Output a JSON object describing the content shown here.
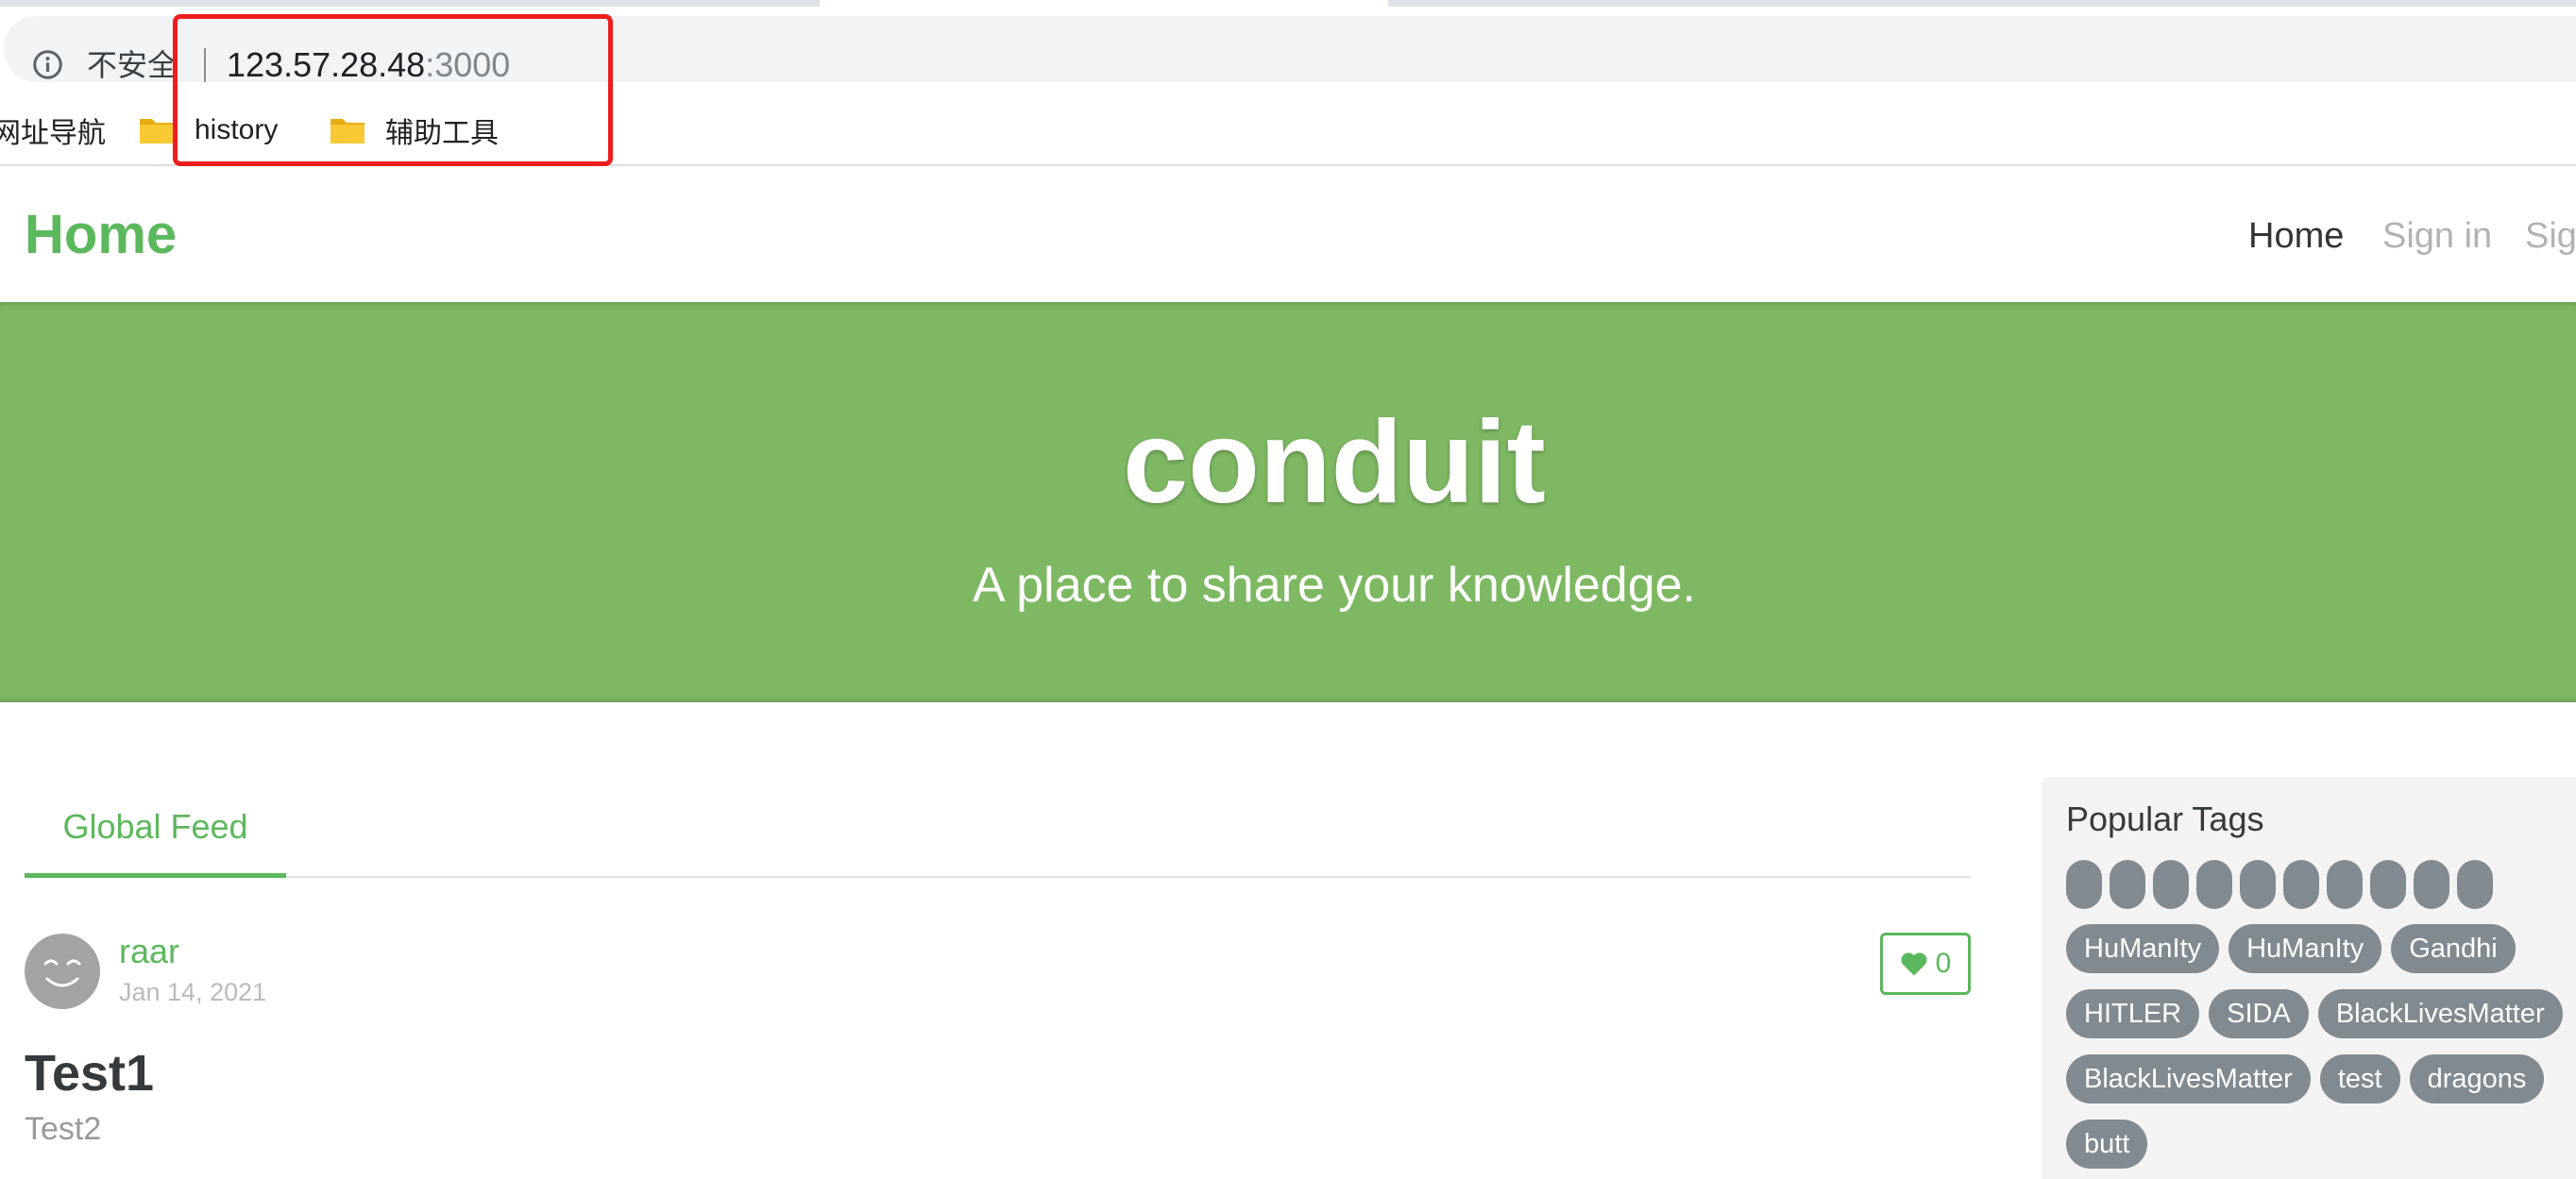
{
  "browser": {
    "insecure_label": "不安全",
    "url_host": "123.57.28.48",
    "url_port": ":3000",
    "bookmarks": [
      {
        "label": "网址导航",
        "icon": "none"
      },
      {
        "label": "history",
        "icon": "folder-icon"
      },
      {
        "label": "辅助工具",
        "icon": "folder-icon"
      }
    ],
    "highlight_color": "#ee1d1d"
  },
  "navbar": {
    "brand": "Home",
    "links": [
      {
        "label": "Home",
        "active": true
      },
      {
        "label": "Sign in",
        "active": false
      },
      {
        "label": "Sig",
        "active": false
      }
    ]
  },
  "banner": {
    "title": "conduit",
    "subtitle": "A place to share your knowledge.",
    "color": "#7eb862"
  },
  "feed": {
    "tabs": [
      {
        "label": "Global Feed",
        "active": true
      }
    ],
    "articles": [
      {
        "author": "raar",
        "date": "Jan 14, 2021",
        "favorites": "0",
        "title": "Test1",
        "description": "Test2"
      }
    ]
  },
  "sidebar": {
    "title": "Popular Tags",
    "blank_tag_count": 10,
    "tag_rows": [
      [
        "HuManIty",
        "HuManIty",
        "Gandhi"
      ],
      [
        "HITLER",
        "SIDA",
        "BlackLivesMatter"
      ],
      [
        "BlackLivesMatter",
        "test",
        "dragons"
      ],
      [
        "butt"
      ]
    ]
  },
  "colors": {
    "accent": "#5cb85c",
    "tag_bg": "#818a91"
  }
}
